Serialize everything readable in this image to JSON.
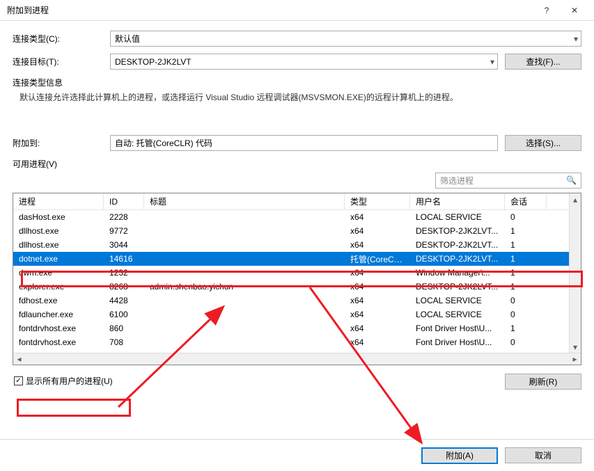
{
  "window": {
    "title": "附加到进程",
    "help": "?",
    "close": "✕"
  },
  "rows": {
    "conn_type_label": "连接类型(C):",
    "conn_type_value": "默认值",
    "conn_target_label": "连接目标(T):",
    "conn_target_value": "DESKTOP-2JK2LVT",
    "find_btn": "查找(F)...",
    "conn_info_label": "连接类型信息",
    "conn_info_text": "默认连接允许选择此计算机上的进程，或选择运行 Visual Studio 远程调试器(MSVSMON.EXE)的远程计算机上的进程。",
    "attach_to_label": "附加到:",
    "attach_to_value": "自动: 托管(CoreCLR) 代码",
    "select_btn": "选择(S)...",
    "avail_label": "可用进程(V)",
    "filter_placeholder": "筛选进程"
  },
  "table": {
    "headers": {
      "proc": "进程",
      "id": "ID",
      "title": "标题",
      "type": "类型",
      "user": "用户名",
      "sess": "会话"
    },
    "rows": [
      {
        "proc": "dasHost.exe",
        "id": "2228",
        "title": "",
        "type": "x64",
        "user": "LOCAL SERVICE",
        "sess": "0",
        "sel": false
      },
      {
        "proc": "dllhost.exe",
        "id": "9772",
        "title": "",
        "type": "x64",
        "user": "DESKTOP-2JK2LVT...",
        "sess": "1",
        "sel": false
      },
      {
        "proc": "dllhost.exe",
        "id": "3044",
        "title": "",
        "type": "x64",
        "user": "DESKTOP-2JK2LVT...",
        "sess": "1",
        "sel": false
      },
      {
        "proc": "dotnet.exe",
        "id": "14616",
        "title": "",
        "type": "托管(CoreCL...",
        "user": "DESKTOP-2JK2LVT...",
        "sess": "1",
        "sel": true
      },
      {
        "proc": "dwm.exe",
        "id": "1232",
        "title": "",
        "type": "x64",
        "user": "Window Manager\\...",
        "sess": "1",
        "sel": false
      },
      {
        "proc": "explorer.exe",
        "id": "8268",
        "title": "admin.shenbao.yichun",
        "type": "x64",
        "user": "DESKTOP-2JK2LVT...",
        "sess": "1",
        "sel": false
      },
      {
        "proc": "fdhost.exe",
        "id": "4428",
        "title": "",
        "type": "x64",
        "user": "LOCAL SERVICE",
        "sess": "0",
        "sel": false
      },
      {
        "proc": "fdlauncher.exe",
        "id": "6100",
        "title": "",
        "type": "x64",
        "user": "LOCAL SERVICE",
        "sess": "0",
        "sel": false
      },
      {
        "proc": "fontdrvhost.exe",
        "id": "860",
        "title": "",
        "type": "x64",
        "user": "Font Driver Host\\U...",
        "sess": "1",
        "sel": false
      },
      {
        "proc": "fontdrvhost.exe",
        "id": "708",
        "title": "",
        "type": "x64",
        "user": "Font Driver Host\\U...",
        "sess": "0",
        "sel": false
      }
    ]
  },
  "below": {
    "show_all_label": "显示所有用户的进程(U)",
    "refresh_btn": "刷新(R)"
  },
  "bottom": {
    "attach_btn": "附加(A)",
    "cancel_btn": "取消"
  }
}
